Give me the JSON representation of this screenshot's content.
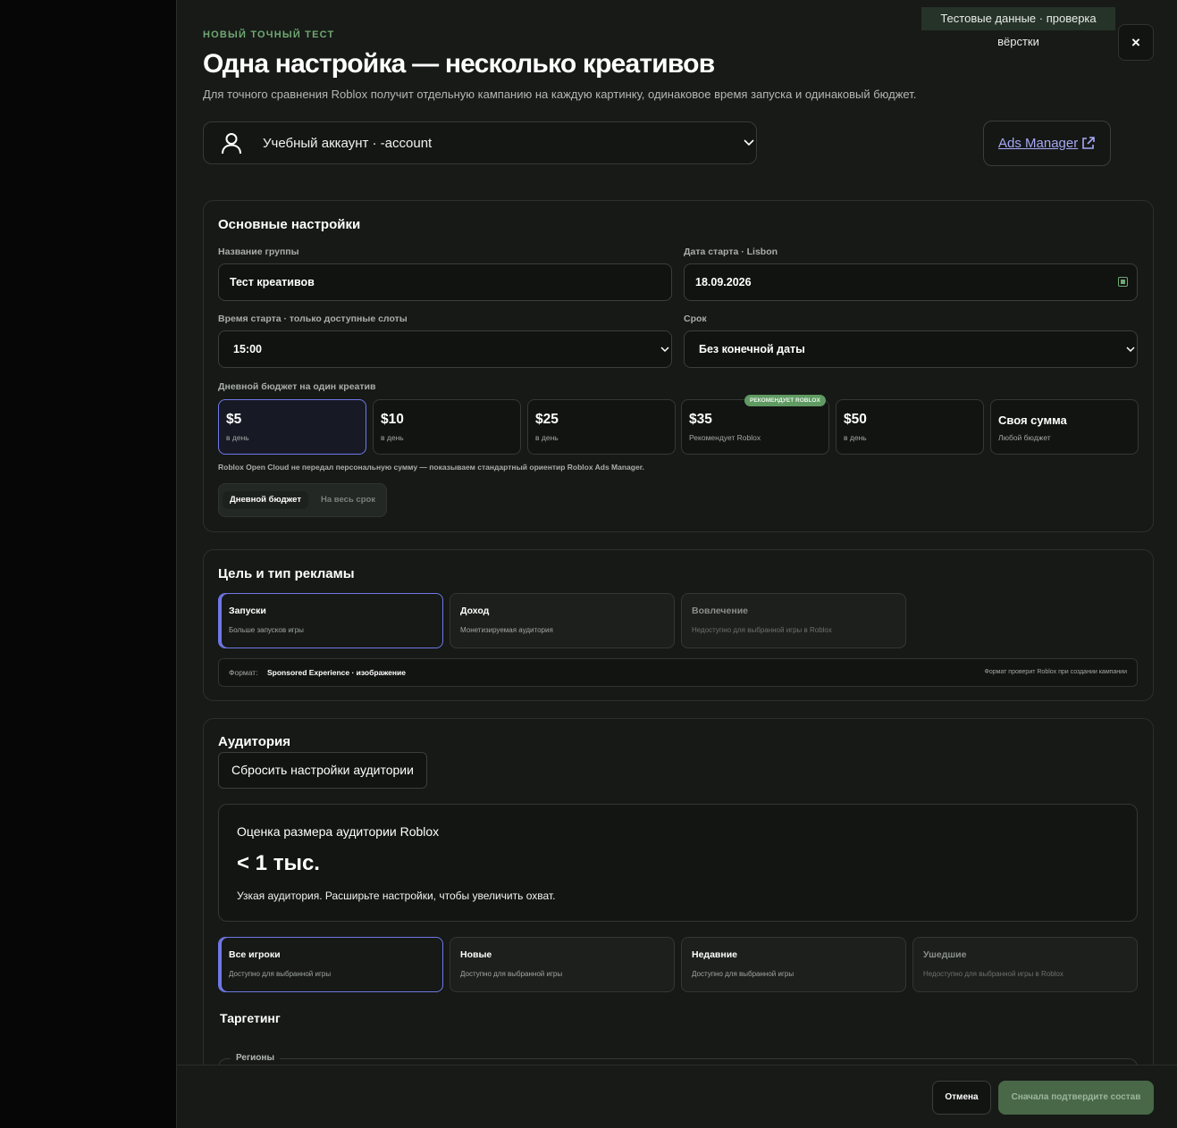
{
  "test_badge": "Тестовые данные · проверка вёрстки",
  "close_label": "×",
  "header": {
    "eyebrow": "НОВЫЙ ТОЧНЫЙ ТЕСТ",
    "title": "Одна настройка — несколько креативов",
    "subtitle": "Для точного сравнения Roblox получит отдельную кампанию на каждую картинку, одинаковое время запуска и одинаковый бюджет."
  },
  "account": {
    "selected": "Учебный аккаунт · -account",
    "icon": "user-icon"
  },
  "ads_manager": {
    "label": "Ads Manager",
    "icon": "external-link-icon"
  },
  "basic": {
    "title": "Основные настройки",
    "group_name_label": "Название группы",
    "group_name_value": "Тест креативов",
    "start_date_label": "Дата старта · Lisbon",
    "start_date_value": "18.09.2026",
    "start_time_label": "Время старта · только доступные слоты",
    "start_time_value": "15:00",
    "duration_label": "Срок",
    "duration_value": "Без конечной даты",
    "budget_label": "Дневной бюджет на один креатив",
    "budgets": [
      {
        "amount": "$5",
        "sub": "в день",
        "selected": true
      },
      {
        "amount": "$10",
        "sub": "в день",
        "selected": false
      },
      {
        "amount": "$25",
        "sub": "в день",
        "selected": false
      },
      {
        "amount": "$35",
        "sub": "Рекомендует Roblox",
        "badge": "РЕКОМЕНДУЕТ ROBLOX",
        "selected": false
      },
      {
        "amount": "$50",
        "sub": "в день",
        "selected": false
      },
      {
        "amount": "Своя сумма",
        "sub": "Любой бюджет",
        "selected": false
      }
    ],
    "budget_note": "Roblox Open Cloud не передал персональную сумму — показываем стандартный ориентир Roblox Ads Manager.",
    "budget_mode": {
      "daily": "Дневной бюджет",
      "lifetime": "На весь срок",
      "active": "daily"
    }
  },
  "goal": {
    "title": "Цель и тип рекламы",
    "options": [
      {
        "title": "Запуски",
        "sub": "Больше запусков игры",
        "selected": true,
        "disabled": false
      },
      {
        "title": "Доход",
        "sub": "Монетизируемая аудитория",
        "selected": false,
        "disabled": false
      },
      {
        "title": "Вовлечение",
        "sub": "Недоступно для выбранной игры в Roblox",
        "selected": false,
        "disabled": true
      }
    ],
    "format_label": "Формат:",
    "format_value": "Sponsored Experience · изображение",
    "format_note": "Формат проверит Roblox при создании кампании"
  },
  "audience": {
    "title": "Аудитория",
    "reset_label": "Сбросить настройки аудитории",
    "estimate_title": "Оценка размера аудитории Roblox",
    "estimate_value": "< 1 тыс.",
    "estimate_desc": "Узкая аудитория. Расширьте настройки, чтобы увеличить охват.",
    "segments": [
      {
        "title": "Все игроки",
        "sub": "Доступно для выбранной игры",
        "selected": true,
        "disabled": false
      },
      {
        "title": "Новые",
        "sub": "Доступно для выбранной игры",
        "selected": false,
        "disabled": false
      },
      {
        "title": "Недавние",
        "sub": "Доступно для выбранной игры",
        "selected": false,
        "disabled": false
      },
      {
        "title": "Ушедшие",
        "sub": "Недоступно для выбранной игры в Roblox",
        "selected": false,
        "disabled": true
      }
    ],
    "targeting_title": "Таргетинг",
    "regions_label": "Регионы"
  },
  "footer": {
    "cancel_label": "Отмена",
    "confirm_label": "Сначала подтвердите состав"
  },
  "colors": {
    "accent": "#6f78e6",
    "green": "#6fa872",
    "confirm_bg": "#486848",
    "link": "#a5a8f4"
  }
}
